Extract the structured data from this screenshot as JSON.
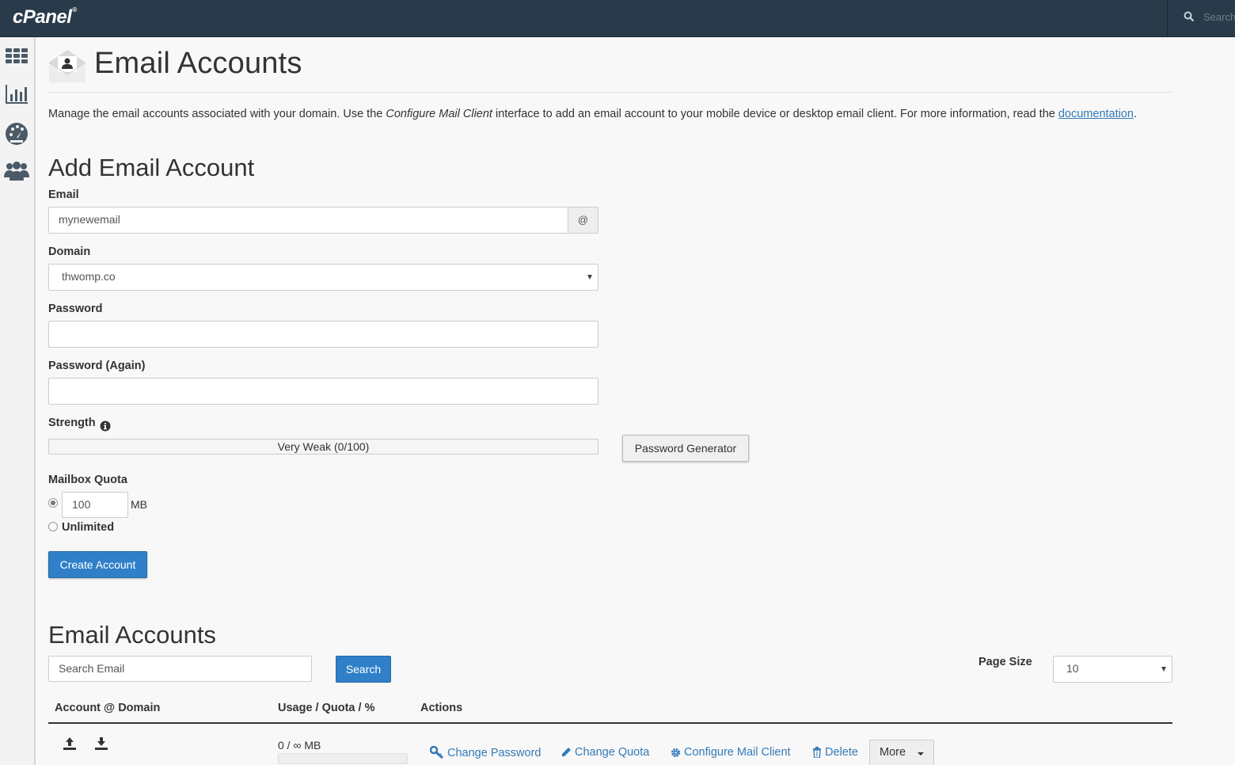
{
  "topbar": {
    "logo": "cPanel",
    "logo_mark": "®",
    "search_placeholder": "Search"
  },
  "nav": {
    "icons": [
      "apps-grid-icon",
      "stats-chart-icon",
      "dashboard-gauge-icon",
      "users-icon"
    ]
  },
  "page": {
    "title": "Email Accounts",
    "intro_before": "Manage the email accounts associated with your domain. Use the ",
    "intro_em": "Configure Mail Client",
    "intro_middle": " interface to add an email account to your mobile device or desktop email client. For more information, read the ",
    "intro_link": "documentation",
    "intro_after": "."
  },
  "add_form": {
    "heading": "Add Email Account",
    "email_label": "Email",
    "email_value": "mynewemail",
    "email_addon": "@",
    "domain_label": "Domain",
    "domain_value": "thwomp.co",
    "password_label": "Password",
    "password_value": "",
    "password_again_label": "Password (Again)",
    "password_again_value": "",
    "strength_label": "Strength",
    "strength_text": "Very Weak (0/100)",
    "strength_score": 0,
    "password_generator_label": "Password Generator",
    "quota_label": "Mailbox Quota",
    "quota_value": "100",
    "quota_unit": "MB",
    "unlimited_label": "Unlimited",
    "quota_selected": "custom",
    "create_button": "Create Account"
  },
  "accounts": {
    "heading": "Email Accounts",
    "search_placeholder": "Search Email",
    "search_button": "Search",
    "page_size_label": "Page Size",
    "page_size_value": "10",
    "columns": [
      "Account @ Domain",
      "Usage / Quota / %",
      "Actions"
    ],
    "rows": [
      {
        "usage": "0 / ∞ MB",
        "actions": [
          "Change Password",
          "Change Quota",
          "Configure Mail Client",
          "Delete"
        ],
        "more": "More"
      }
    ]
  },
  "colors": {
    "topbar": "#293a4a",
    "primary": "#2f80c8",
    "link": "#337ab7"
  }
}
